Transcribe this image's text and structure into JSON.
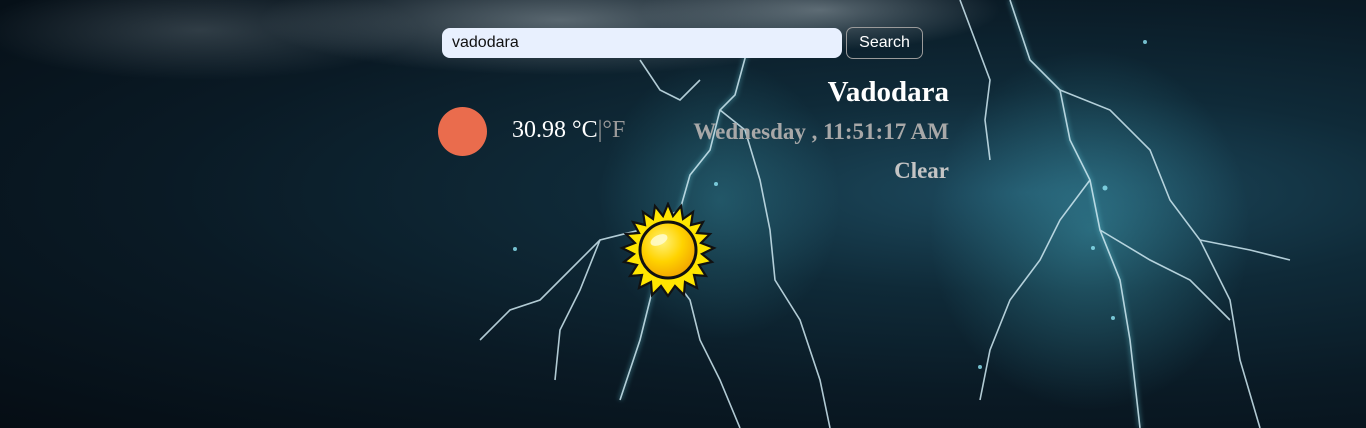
{
  "search": {
    "value": "vadodara",
    "placeholder": "",
    "button_label": "Search"
  },
  "weather": {
    "temperature": "30.98",
    "unit_c": "°C",
    "unit_separator": "|",
    "unit_f": "°F",
    "city": "Vadodara",
    "datetime": "Wednesday , 11:51:17 AM",
    "condition": "Clear",
    "icon": "sun-icon",
    "status_color": "#ea6c4d"
  },
  "background": {
    "theme": "thunderstorm-lightning"
  }
}
